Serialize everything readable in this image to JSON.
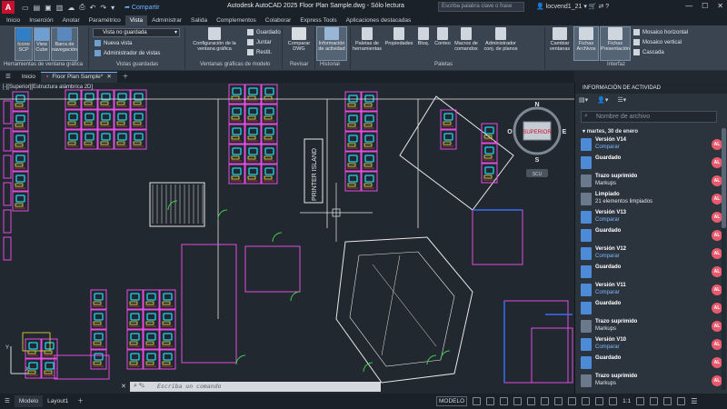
{
  "titlebar": {
    "logo_letter": "A",
    "share_label": "Compartir",
    "title": "Autodesk AutoCAD 2025    Floor Plan Sample.dwg - Sólo lectura",
    "search_placeholder": "Escriba palabra clave o frase",
    "username": "locvend1_21"
  },
  "ribbon_tabs": [
    "Inicio",
    "Inserción",
    "Anotar",
    "Paramétrico",
    "Vista",
    "Administrar",
    "Salida",
    "Complementos",
    "Colaborar",
    "Express Tools",
    "Aplicaciones destacadas"
  ],
  "active_tab": "Vista",
  "ribbon": {
    "viewport_tools": {
      "label": "Herramientas de ventana gráfica",
      "ucs_icon": "Icono SCP",
      "view_cube": "View Cube",
      "nav_bar": "Barra de navegación"
    },
    "named_views": {
      "label": "Vistas guardadas",
      "combo_value": "Vista no guardada",
      "new_view": "Nueva vista",
      "view_manager": "Administrador de vistas"
    },
    "model_viewports": {
      "label": "Ventanas gráficas de modelo",
      "config": "Configuración de la ventana gráfica",
      "save": "Guardado",
      "join": "Juntar",
      "restore": "Restit."
    },
    "compare": {
      "label": "Revisar",
      "btn": "Comparar DWG"
    },
    "history": {
      "label": "Historial",
      "btn": "Información de actividad"
    },
    "palettes": {
      "label": "Paletas",
      "tool_palettes": "Paletas de herramientas",
      "properties": "Propiedades",
      "block": "Bloq.",
      "count": "Conteo",
      "macros": "Macros de comandos",
      "sheet_set": "Administrador conj. de planos"
    },
    "interface": {
      "label": "Interfaz",
      "switch_windows": "Cambiar ventanas",
      "file_tabs": "Fichas Archivos",
      "layout_tabs": "Fichas Presentación",
      "tile_h": "Mosaico horizontal",
      "tile_v": "Mosaico vertical",
      "cascade": "Cascada"
    }
  },
  "file_tabs": [
    "Inicio",
    "Floor Plan Sample*"
  ],
  "viewport_label": "[-][Superior][Estructura alámbrica 2D]",
  "viewcube": {
    "top": "SUPERIOR",
    "n": "N",
    "s": "S",
    "e": "E",
    "w": "O",
    "ucs": "SCU"
  },
  "drawing_label": "PRINTER ISLAND",
  "command_placeholder": "Escriba un comando",
  "layout_tabs": [
    "Modelo",
    "Layout1"
  ],
  "status": {
    "model": "MODELO",
    "scale": "1:1"
  },
  "activity": {
    "title": "INFORMACIÓN DE ACTIVIDAD",
    "search_placeholder": "Nombre de archivo",
    "date_group": "martes, 30 de enero",
    "avatar": "AL",
    "items": [
      {
        "title": "Versión V14",
        "sub": "Comparar",
        "link": true,
        "icon_color": "#4e8bd6"
      },
      {
        "title": "Guardado",
        "sub": "",
        "link": false,
        "icon_color": "#4e8bd6"
      },
      {
        "title": "Trazo suprimido",
        "sub": "Markups",
        "link": false,
        "icon_color": "#6a7a8c"
      },
      {
        "title": "Limpiado",
        "sub": "21 elementos limpiados",
        "link": false,
        "icon_color": "#6a7a8c"
      },
      {
        "title": "Versión V13",
        "sub": "Comparar",
        "link": true,
        "icon_color": "#4e8bd6"
      },
      {
        "title": "Guardado",
        "sub": "",
        "link": false,
        "icon_color": "#4e8bd6"
      },
      {
        "title": "Versión V12",
        "sub": "Comparar",
        "link": true,
        "icon_color": "#4e8bd6"
      },
      {
        "title": "Guardado",
        "sub": "",
        "link": false,
        "icon_color": "#4e8bd6"
      },
      {
        "title": "Versión V11",
        "sub": "Comparar",
        "link": true,
        "icon_color": "#4e8bd6"
      },
      {
        "title": "Guardado",
        "sub": "",
        "link": false,
        "icon_color": "#4e8bd6"
      },
      {
        "title": "Trazo suprimido",
        "sub": "Markups",
        "link": false,
        "icon_color": "#6a7a8c"
      },
      {
        "title": "Versión V10",
        "sub": "Comparar",
        "link": true,
        "icon_color": "#4e8bd6"
      },
      {
        "title": "Guardado",
        "sub": "",
        "link": false,
        "icon_color": "#4e8bd6"
      },
      {
        "title": "Trazo suprimido",
        "sub": "Markups",
        "link": false,
        "icon_color": "#6a7a8c"
      }
    ]
  },
  "colors": {
    "magenta": "#e34de0",
    "cyan": "#22d3ee",
    "yellow": "#f0e040",
    "red": "#ff4040",
    "green": "#45d04b",
    "white": "#e8e8e8",
    "blue": "#3a6cf0"
  }
}
